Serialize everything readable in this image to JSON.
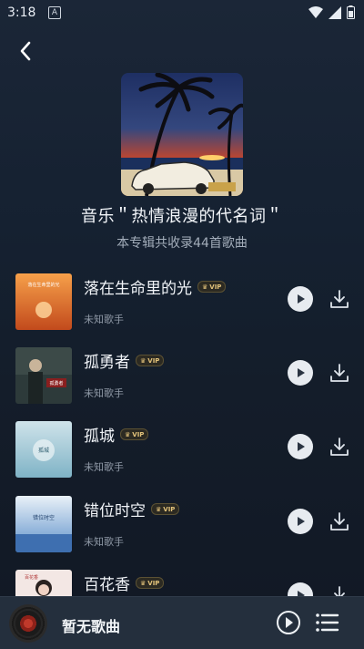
{
  "status": {
    "time": "3:18",
    "notif_letter": "A"
  },
  "album": {
    "title": "音乐＂热情浪漫的代名词＂",
    "subtitle": "本专辑共收录44首歌曲"
  },
  "vip_label": "VIP",
  "songs": [
    {
      "title": "落在生命里的光",
      "artist": "未知歌手",
      "cover_text": "落在生命里的光"
    },
    {
      "title": "孤勇者",
      "artist": "未知歌手",
      "cover_text": "孤勇者"
    },
    {
      "title": "孤城",
      "artist": "未知歌手",
      "cover_text": "孤城"
    },
    {
      "title": "错位时空",
      "artist": "未知歌手",
      "cover_text": "错位时空"
    },
    {
      "title": "百花香",
      "artist": "",
      "cover_text": "百花香"
    }
  ],
  "player": {
    "now_playing": "暂无歌曲"
  }
}
